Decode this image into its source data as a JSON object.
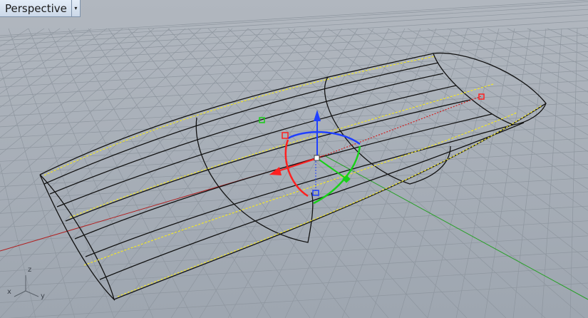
{
  "viewport": {
    "title": "Perspective",
    "menu_glyph": "▾"
  },
  "axis_indicator": {
    "x_label": "x",
    "y_label": "y",
    "z_label": "z"
  },
  "colors": {
    "background": "#a9b0b9",
    "grid": "#8e969f",
    "x_axis": "#b02020",
    "y_axis": "#28a028",
    "wire": "#111111",
    "highlight": "#f2e627",
    "gumball_x": "#ff2020",
    "gumball_y": "#18d018",
    "gumball_z": "#2040ff"
  }
}
